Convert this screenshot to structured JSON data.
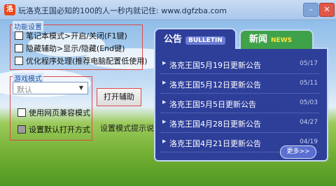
{
  "window": {
    "title": "玩洛克王国必知的100的人一秒内就记住: www.dgfzba.com",
    "icon_label": "洛",
    "min_label": "–",
    "close_label": "✕"
  },
  "options": {
    "legend": "功能设置",
    "items": [
      {
        "label": "笔记本模式>开启/关闭(F1键)"
      },
      {
        "label": "隐藏辅助>显示/隐藏(End键)"
      },
      {
        "label": "优化程序处理(推荐电脑配置低使用)"
      }
    ]
  },
  "mode": {
    "legend": "游戏模式",
    "select_value": "默认",
    "select_arrow": "▼",
    "compat_label": "使用网页兼容模式",
    "default_label": "设置默认打开方式"
  },
  "open_button_label": "打开辅助",
  "note_text": "设置模式提示说明",
  "news": {
    "tab_bulletin": "公告",
    "tab_bulletin_en": "BULLETIN",
    "tab_news": "新闻",
    "tab_news_en": "NEWS",
    "items": [
      {
        "title": "洛克王国5月19日更新公告",
        "date": "05/17"
      },
      {
        "title": "洛克王国5月12日更新公告",
        "date": "05/11"
      },
      {
        "title": "洛克王国5月5日更新公告",
        "date": "05/03"
      },
      {
        "title": "洛克王国4月28日更新公告",
        "date": "04/27"
      },
      {
        "title": "洛克王国4月21日更新公告",
        "date": "04/19"
      }
    ],
    "more_label": "更多>>"
  },
  "colors": {
    "highlight_border": "#e04848",
    "panel_blue": "#2e3f9a",
    "tab_green": "#3fa24a"
  }
}
